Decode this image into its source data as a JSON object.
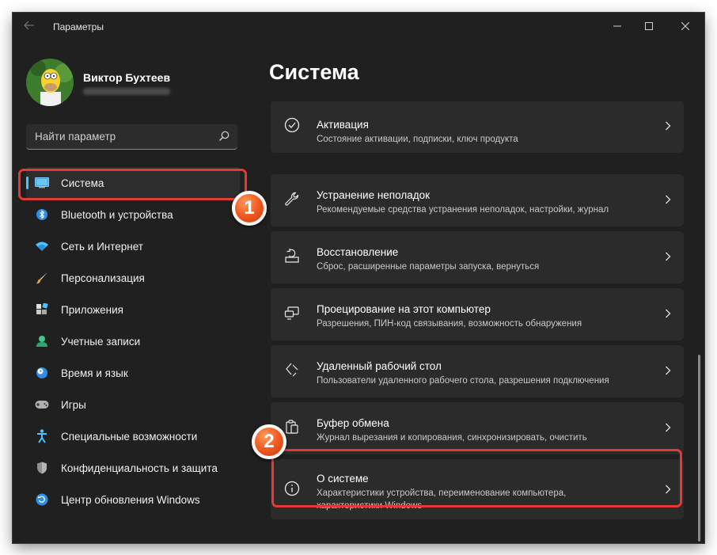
{
  "window": {
    "title": "Параметры",
    "controls": {
      "minimize_icon": "minimize-icon",
      "maximize_icon": "maximize-icon",
      "close_icon": "close-icon"
    }
  },
  "profile": {
    "name": "Виктор Бухтеев"
  },
  "search": {
    "placeholder": "Найти параметр",
    "icon": "search-icon"
  },
  "sidebar": {
    "items": [
      {
        "label": "Система",
        "icon": "monitor-icon",
        "active": true
      },
      {
        "label": "Bluetooth и устройства",
        "icon": "bluetooth-icon"
      },
      {
        "label": "Сеть и Интернет",
        "icon": "wifi-icon"
      },
      {
        "label": "Персонализация",
        "icon": "brush-icon"
      },
      {
        "label": "Приложения",
        "icon": "apps-icon"
      },
      {
        "label": "Учетные записи",
        "icon": "person-icon"
      },
      {
        "label": "Время и язык",
        "icon": "clock-globe-icon"
      },
      {
        "label": "Игры",
        "icon": "gamepad-icon"
      },
      {
        "label": "Специальные возможности",
        "icon": "accessibility-icon"
      },
      {
        "label": "Конфиденциальность и защита",
        "icon": "shield-icon"
      },
      {
        "label": "Центр обновления Windows",
        "icon": "update-icon"
      }
    ]
  },
  "main": {
    "title": "Система",
    "cards": [
      {
        "title": "Активация",
        "subtitle": "Состояние активации, подписки, ключ продукта",
        "icon": "check-circle-icon"
      },
      {
        "title": "Устранение неполадок",
        "subtitle": "Рекомендуемые средства устранения неполадок, настройки, журнал",
        "icon": "wrench-icon"
      },
      {
        "title": "Восстановление",
        "subtitle": "Сброс, расширенные параметры запуска, вернуться",
        "icon": "recovery-icon"
      },
      {
        "title": "Проецирование на этот компьютер",
        "subtitle": "Разрешения, ПИН-код связывания, возможность обнаружения",
        "icon": "project-icon"
      },
      {
        "title": "Удаленный рабочий стол",
        "subtitle": "Пользователи удаленного рабочего стола, разрешения подключения",
        "icon": "remote-desktop-icon"
      },
      {
        "title": "Буфер обмена",
        "subtitle": "Журнал вырезания и копирования, синхронизировать, очистить",
        "icon": "clipboard-icon"
      },
      {
        "title": "О системе",
        "subtitle": "Характеристики устройства, переименование компьютера, характеристики Windows",
        "icon": "info-icon"
      }
    ]
  },
  "annotations": {
    "badge1": "1",
    "badge2": "2",
    "highlight_color": "#e53935",
    "badge_color": "#f05a22"
  },
  "colors": {
    "background": "#202020",
    "card": "#2b2b2b",
    "accent": "#4cc2ff"
  }
}
